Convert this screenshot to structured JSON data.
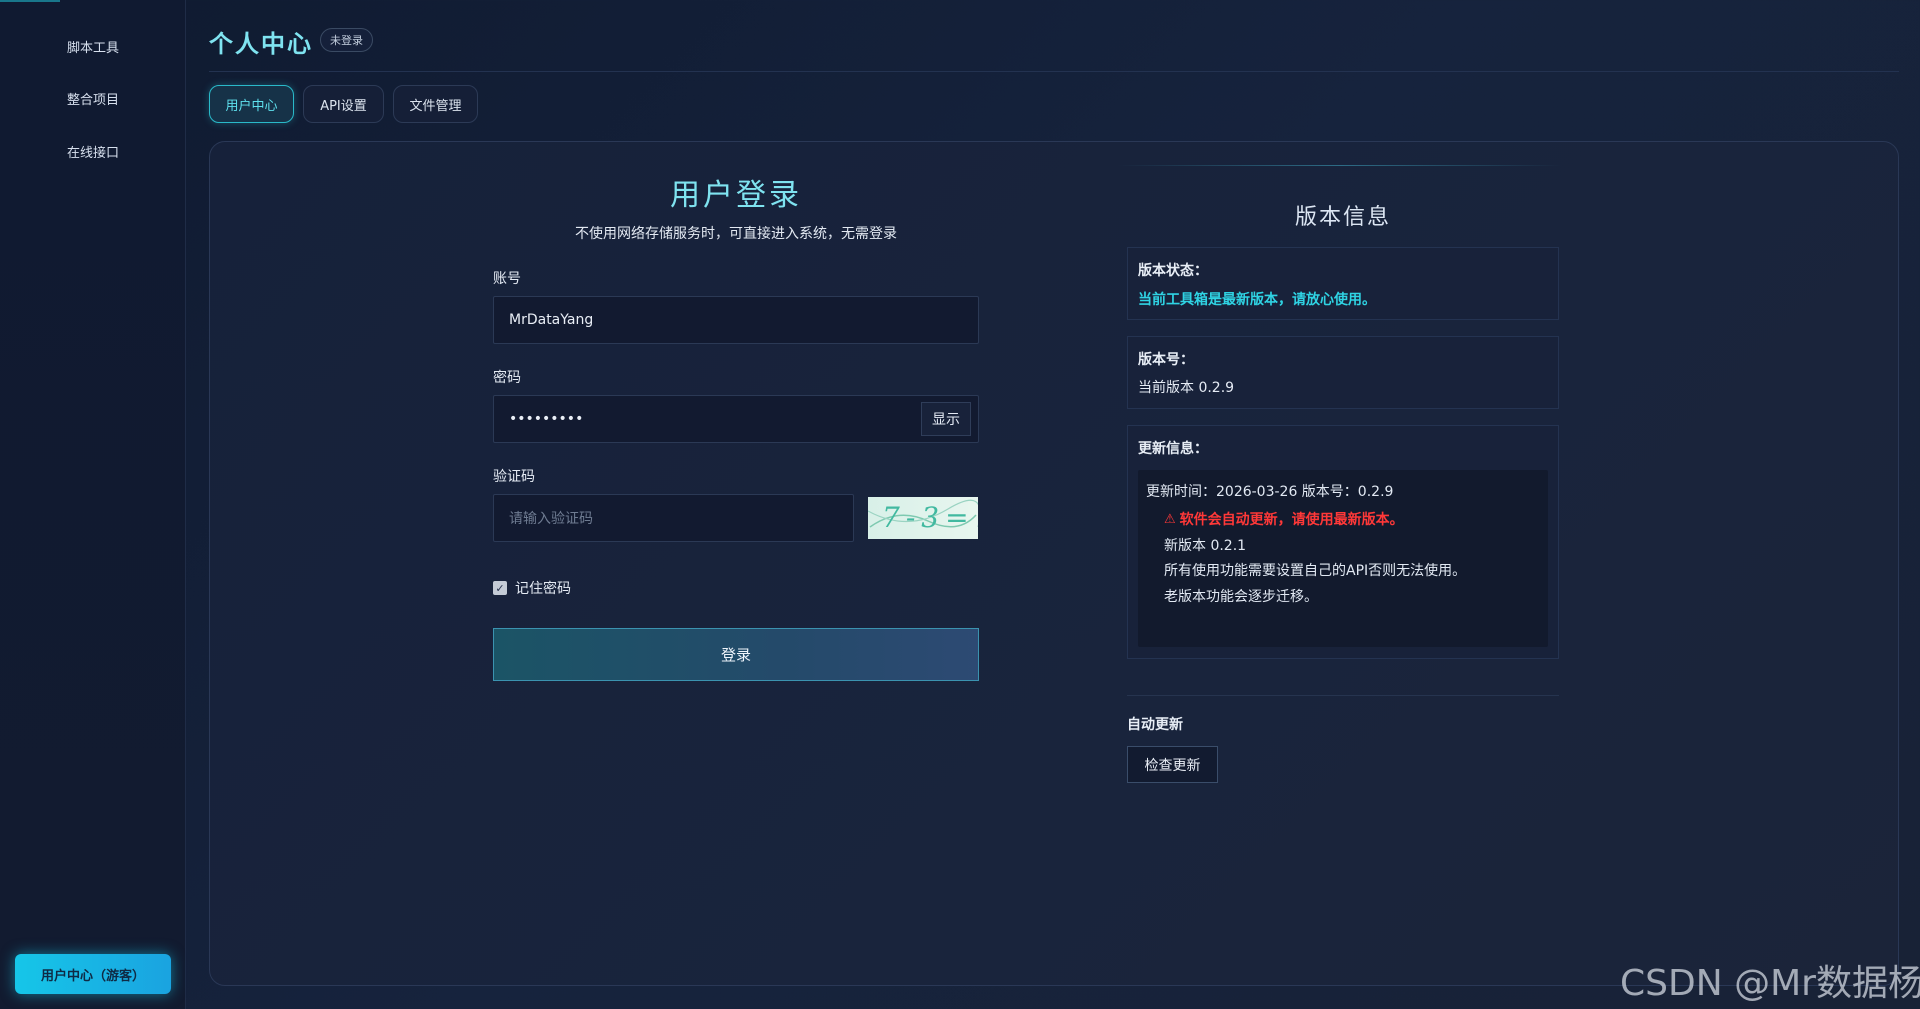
{
  "sidebar": {
    "items": [
      {
        "label": "脚本工具"
      },
      {
        "label": "整合项目"
      },
      {
        "label": "在线接口"
      }
    ],
    "user_button": "用户中心（游客）"
  },
  "header": {
    "title": "个人中心",
    "badge": "未登录"
  },
  "tabs": [
    {
      "label": "用户中心",
      "active": true
    },
    {
      "label": "API设置",
      "active": false
    },
    {
      "label": "文件管理",
      "active": false
    }
  ],
  "login": {
    "title": "用户登录",
    "subtitle": "不使用网络存储服务时，可直接进入系统，无需登录",
    "account_label": "账号",
    "account_value": "MrDataYang",
    "password_label": "密码",
    "password_value": "•••••••••",
    "show_button": "显示",
    "captcha_label": "验证码",
    "captcha_placeholder": "请输入验证码",
    "captcha_text": "7-3=",
    "remember_label": "记住密码",
    "remember_checked": true,
    "submit": "登录"
  },
  "version": {
    "title": "版本信息",
    "status_label": "版本状态：",
    "status_text": "当前工具箱是最新版本，请放心使用。",
    "number_label": "版本号：",
    "number_text": "当前版本 0.2.9",
    "update_label": "更新信息：",
    "update_lines": [
      "更新时间：2026-03-26 版本号：0.2.9",
      "软件会自动更新，请使用最新版本。",
      "新版本 0.2.1",
      "所有使用功能需要设置自己的API否则无法使用。",
      "老版本功能会逐步迁移。"
    ],
    "auto_update_label": "自动更新",
    "check_button": "检查更新"
  },
  "watermark": "CSDN @Mr数据杨",
  "colors": {
    "accent": "#16c6e8",
    "title": "#7fe3f0",
    "status_ok": "#2fd3e3",
    "warning": "#ff3838"
  }
}
